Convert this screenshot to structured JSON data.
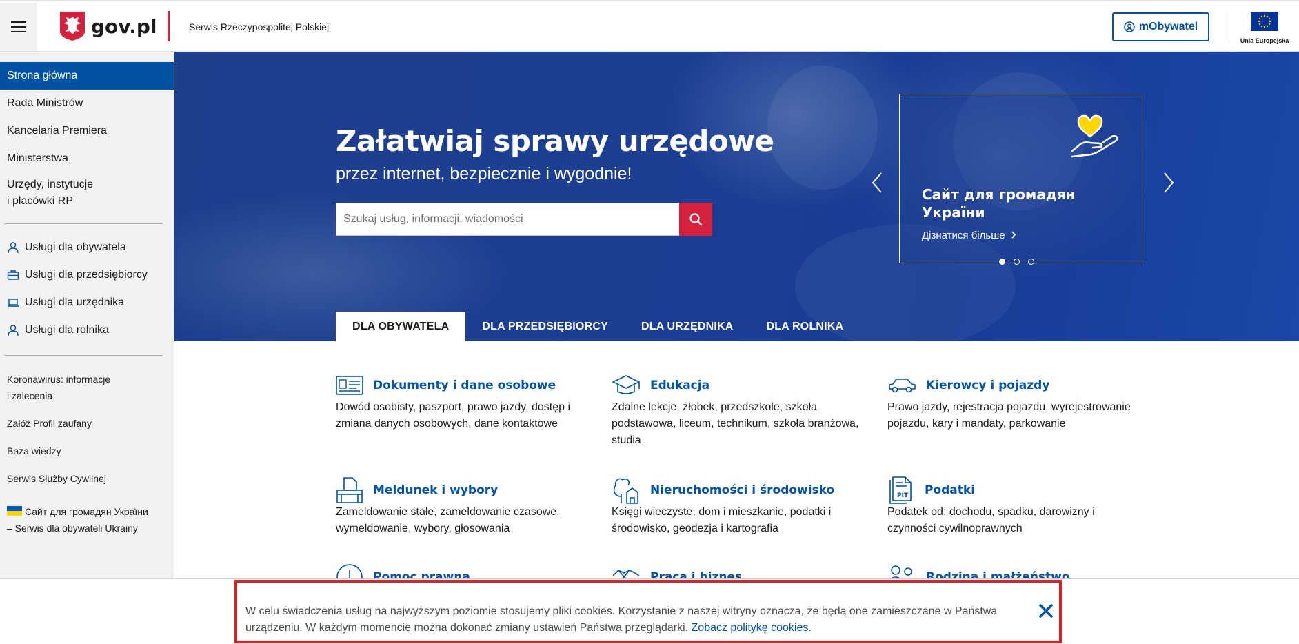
{
  "header": {
    "logo_text": "gov.pl",
    "subtitle": "Serwis Rzeczypospolitej Polskiej",
    "mobywatel_label": "mObywatel",
    "eu_label": "Unia Europejska"
  },
  "sidebar": {
    "main_items": [
      {
        "label": "Strona główna",
        "active": true
      },
      {
        "label": "Rada Ministrów"
      },
      {
        "label": "Kancelaria Premiera"
      },
      {
        "label": "Ministerstwa"
      },
      {
        "label": "Urzędy, instytucje\ni placówki RP"
      }
    ],
    "services": [
      {
        "label": "Usługi dla obywatela",
        "icon": "person-icon"
      },
      {
        "label": "Usługi dla przedsiębiorcy",
        "icon": "briefcase-icon"
      },
      {
        "label": "Usługi dla urzędnika",
        "icon": "laptop-icon"
      },
      {
        "label": "Usługi dla rolnika",
        "icon": "person-icon"
      }
    ],
    "links": [
      {
        "label": "Koronawirus: informacje\ni zalecenia"
      },
      {
        "label": "Załóż Profil zaufany"
      },
      {
        "label": "Baza wiedzy"
      },
      {
        "label": "Serwis Służby Cywilnej"
      }
    ],
    "ukraine_link": "Сайт для громадян України\n– Serwis dla obywateli Ukrainy"
  },
  "hero": {
    "title": "Załatwiaj sprawy urzędowe",
    "subtitle": "przez internet, bezpiecznie i wygodnie!",
    "search_placeholder": "Szukaj usług, informacji, wiadomości",
    "promo_title": "Сайт для громадян України",
    "promo_link": "Дізнатися більше",
    "slides_total": 3,
    "slide_active": 1
  },
  "tabs": [
    {
      "label": "DLA OBYWATELA",
      "active": true
    },
    {
      "label": "DLA PRZEDSIĘBIORCY"
    },
    {
      "label": "DLA URZĘDNIKA"
    },
    {
      "label": "DLA ROLNIKA"
    }
  ],
  "categories": [
    {
      "title": "Dokumenty i dane osobowe",
      "icon": "id-card-icon",
      "desc": "Dowód osobisty, paszport, prawo jazdy, dostęp i zmiana danych osobowych, dane kontaktowe"
    },
    {
      "title": "Edukacja",
      "icon": "graduation-cap-icon",
      "desc": "Zdalne lekcje, żłobek, przedszkole, szkoła podstawowa, liceum, technikum, szkoła branżowa, studia"
    },
    {
      "title": "Kierowcy i pojazdy",
      "icon": "car-icon",
      "desc": "Prawo jazdy, rejestracja pojazdu, wyrejestrowanie pojazdu, kary i mandaty, parkowanie"
    },
    {
      "title": "Meldunek i wybory",
      "icon": "ballot-box-icon",
      "desc": "Zameldowanie stałe, zameldowanie czasowe, wymeldowanie, wybory, głosowania"
    },
    {
      "title": "Nieruchomości i środowisko",
      "icon": "tree-house-icon",
      "desc": "Księgi wieczyste, dom i mieszkanie, podatki i środowisko, geodezja i kartografia"
    },
    {
      "title": "Podatki",
      "icon": "pit-document-icon",
      "desc": "Podatek od: dochodu, spadku, darowizny i czynności cywilnoprawnych"
    },
    {
      "title": "Pomoc prawna",
      "icon": "legal-help-icon",
      "desc": ""
    },
    {
      "title": "Praca i biznes",
      "icon": "handshake-icon",
      "desc": ""
    },
    {
      "title": "Rodzina i małżeństwo",
      "icon": "family-icon",
      "desc": ""
    }
  ],
  "cookie": {
    "text": "W celu świadczenia usług na najwyższym poziomie stosujemy pliki cookies. Korzystanie z naszej witryny oznacza, że będą one zamieszczane w Państwa urządzeniu. W każdym momencie można dokonać zmiany ustawień Państwa przeglądarki. ",
    "link": "Zobacz politykę cookies."
  },
  "colors": {
    "primary_blue": "#0052a5",
    "brand_red": "#d4213d",
    "hero_blue": "#1d3f93",
    "cookie_border": "#e0201f"
  }
}
